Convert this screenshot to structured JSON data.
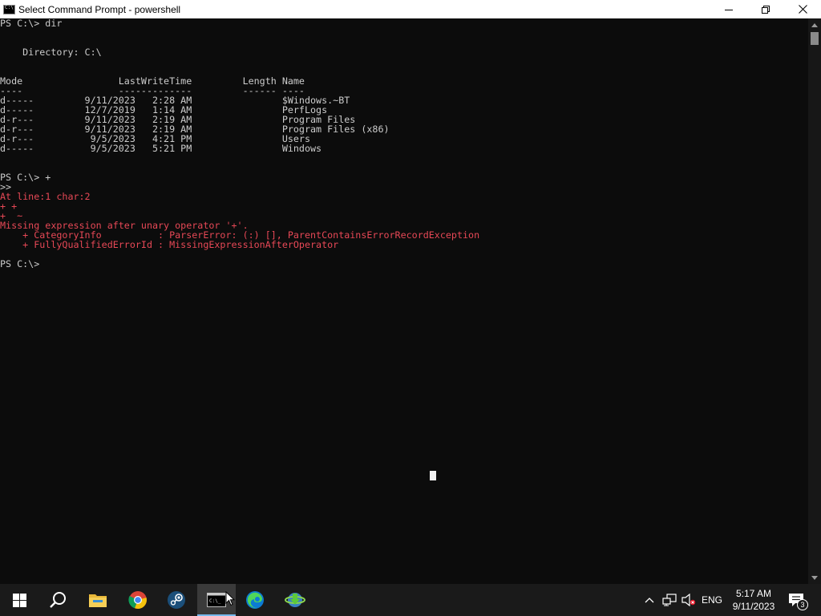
{
  "window": {
    "title": "Select Command Prompt - powershell"
  },
  "console": {
    "lines": [
      {
        "text": "PS C:\\> dir",
        "style": "white"
      },
      {
        "text": "",
        "style": "white"
      },
      {
        "text": "",
        "style": "white"
      },
      {
        "text": "    Directory: C:\\",
        "style": "white"
      },
      {
        "text": "",
        "style": "white"
      },
      {
        "text": "",
        "style": "white"
      },
      {
        "text": "Mode                 LastWriteTime         Length Name",
        "style": "white"
      },
      {
        "text": "----                 -------------         ------ ----",
        "style": "white"
      },
      {
        "text": "d-----         9/11/2023   2:28 AM                $Windows.~BT",
        "style": "white"
      },
      {
        "text": "d-----         12/7/2019   1:14 AM                PerfLogs",
        "style": "white"
      },
      {
        "text": "d-r---         9/11/2023   2:19 AM                Program Files",
        "style": "white"
      },
      {
        "text": "d-r---         9/11/2023   2:19 AM                Program Files (x86)",
        "style": "white"
      },
      {
        "text": "d-r---          9/5/2023   4:21 PM                Users",
        "style": "white"
      },
      {
        "text": "d-----          9/5/2023   5:21 PM                Windows",
        "style": "white"
      },
      {
        "text": "",
        "style": "white"
      },
      {
        "text": "",
        "style": "white"
      },
      {
        "text": "PS C:\\> +",
        "style": "white"
      },
      {
        "text": ">>",
        "style": "white"
      },
      {
        "text": "At line:1 char:2",
        "style": "err"
      },
      {
        "text": "+ +",
        "style": "err"
      },
      {
        "text": "+  ~",
        "style": "err"
      },
      {
        "text": "Missing expression after unary operator '+'.",
        "style": "err"
      },
      {
        "text": "    + CategoryInfo          : ParserError: (:) [], ParentContainsErrorRecordException",
        "style": "err"
      },
      {
        "text": "    + FullyQualifiedErrorId : MissingExpressionAfterOperator",
        "style": "err"
      },
      {
        "text": "",
        "style": "white"
      },
      {
        "text": "PS C:\\>",
        "style": "white"
      }
    ]
  },
  "taskbar": {
    "apps": [
      {
        "name": "start-button",
        "icon": "windows-logo-icon"
      },
      {
        "name": "search-button",
        "icon": "search-icon"
      },
      {
        "name": "file-explorer",
        "icon": "folder-icon"
      },
      {
        "name": "chrome",
        "icon": "chrome-icon"
      },
      {
        "name": "steam",
        "icon": "steam-icon"
      },
      {
        "name": "command-prompt",
        "icon": "cmd-icon",
        "active": true
      },
      {
        "name": "edge",
        "icon": "edge-icon"
      },
      {
        "name": "internet-download-manager",
        "icon": "idm-icon"
      }
    ],
    "tray": {
      "language": "ENG",
      "time": "5:17 AM",
      "date": "9/11/2023",
      "notification_count": "3"
    }
  },
  "colors": {
    "console_bg": "#0c0c0c",
    "console_text": "#cccccc",
    "error_text": "#e74856",
    "taskbar_bg": "#1a1a1a",
    "accent": "#76b9ed"
  }
}
